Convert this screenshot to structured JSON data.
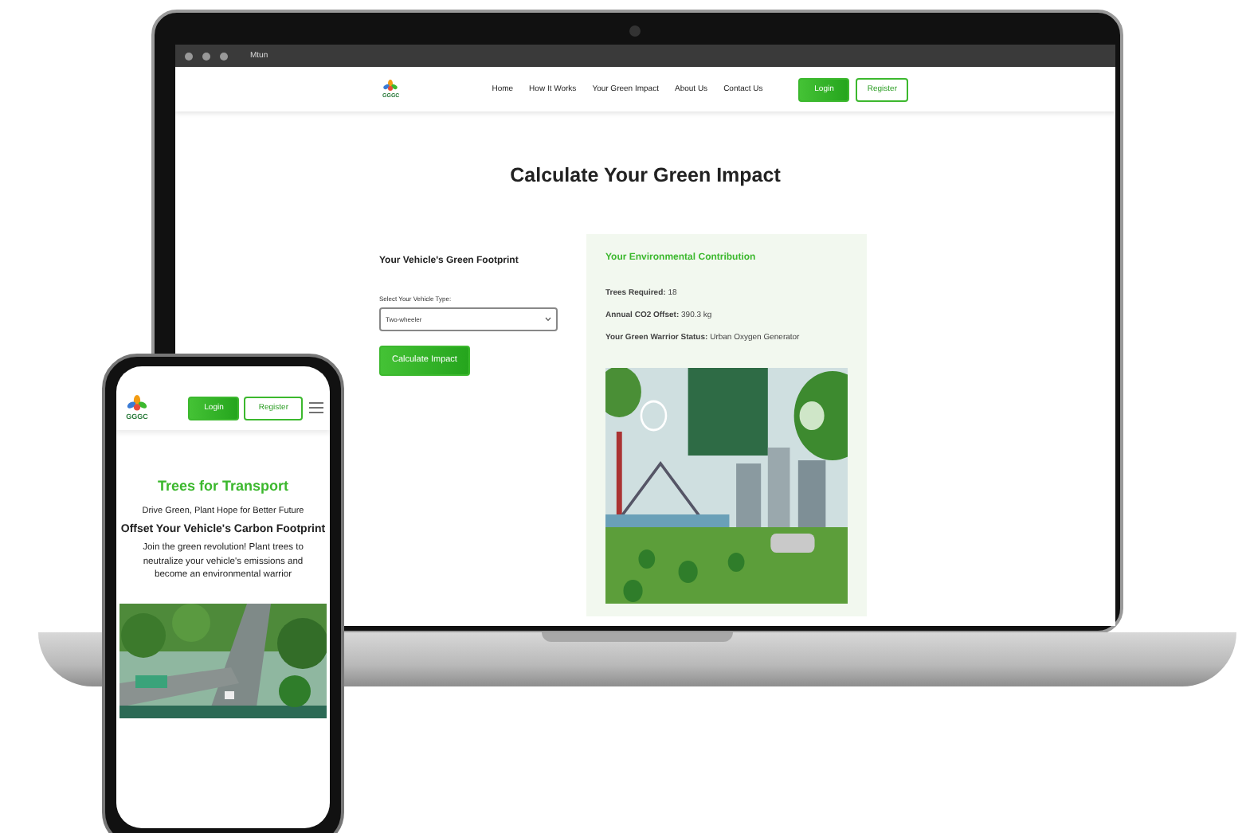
{
  "laptop": {
    "browser": {
      "address": "Mtun"
    },
    "site": {
      "logo": "GGGC",
      "nav": [
        {
          "label": "Home"
        },
        {
          "label": "How It Works"
        },
        {
          "label": "Your Green Impact"
        },
        {
          "label": "About Us"
        },
        {
          "label": "Contact Us"
        }
      ],
      "login": "Login",
      "register": "Register"
    },
    "title": "Calculate Your Green Impact",
    "form": {
      "heading": "Your Vehicle's Green Footprint",
      "select_label": "Select Your Vehicle Type:",
      "select_value": "Two-wheeler",
      "button": "Calculate Impact"
    },
    "result": {
      "heading": "Your Environmental Contribution",
      "lines": [
        {
          "label": "Trees Required:",
          "value": "18"
        },
        {
          "label": "Annual CO2 Offset:",
          "value": "390.3 kg"
        },
        {
          "label": "Your Green Warrior Status:",
          "value": "Urban Oxygen Generator"
        }
      ]
    }
  },
  "phone": {
    "logo": "GGGC",
    "login": "Login",
    "register": "Register",
    "title": "Trees for Transport",
    "tagline": "Drive Green, Plant Hope for Better Future",
    "subtitle": "Offset Your Vehicle's Carbon Footprint",
    "intro": "Join the green revolution! Plant trees to neutralize your vehicle's emissions and become an environmental warrior"
  }
}
